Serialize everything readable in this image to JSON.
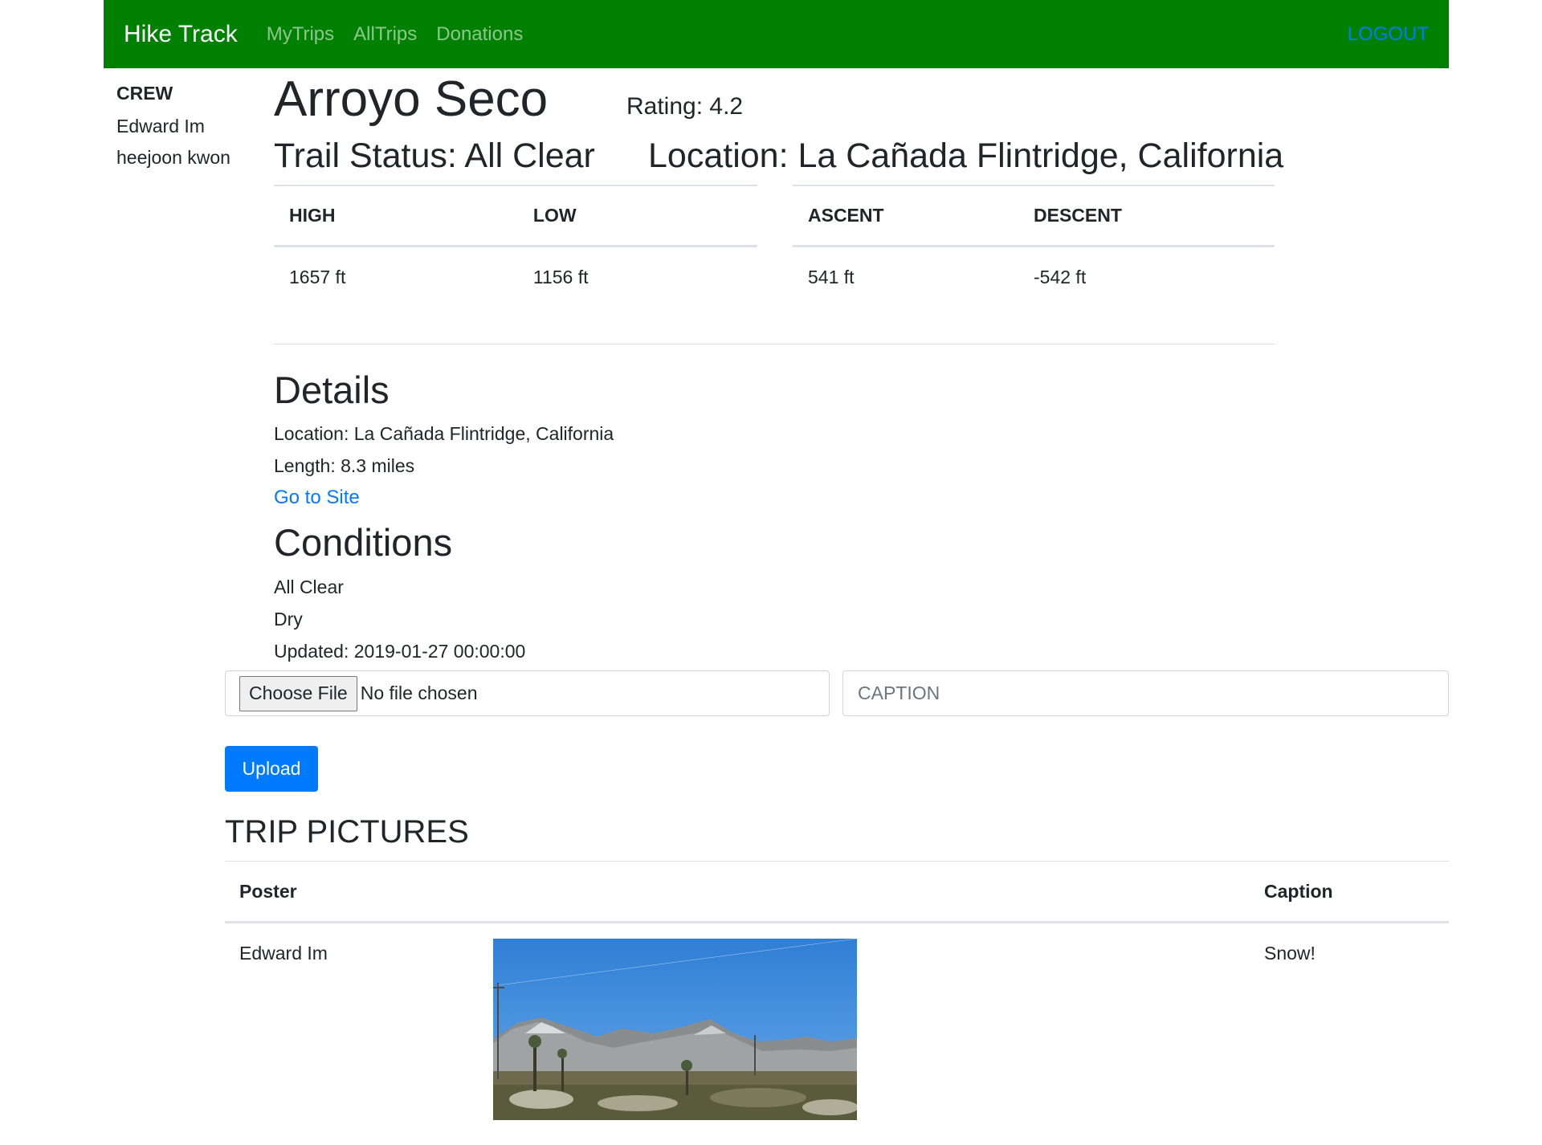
{
  "navbar": {
    "brand": "Hike Track",
    "links": [
      "MyTrips",
      "AllTrips",
      "Donations"
    ],
    "logout": "LOGOUT"
  },
  "crew": {
    "title": "CREW",
    "members": [
      "Edward Im",
      "heejoon kwon"
    ]
  },
  "trail": {
    "name": "Arroyo Seco",
    "rating": "Rating: 4.2",
    "status": "Trail Status: All Clear",
    "location": "Location: La Cañada Flintridge, California"
  },
  "elevation": {
    "headers_left": [
      "HIGH",
      "LOW"
    ],
    "values_left": [
      "1657 ft",
      "1156 ft"
    ],
    "headers_right": [
      "ASCENT",
      "DESCENT"
    ],
    "values_right": [
      "541 ft",
      "-542 ft"
    ]
  },
  "details": {
    "heading": "Details",
    "location": "Location: La Cañada Flintridge, California",
    "length": "Length: 8.3 miles",
    "link": "Go to Site"
  },
  "conditions": {
    "heading": "Conditions",
    "status": "All Clear",
    "surface": "Dry",
    "updated": "Updated: 2019-01-27 00:00:00"
  },
  "upload": {
    "choose_file": "Choose File",
    "file_status": "No file chosen",
    "caption_placeholder": "CAPTION",
    "button": "Upload"
  },
  "pictures": {
    "heading": "TRIP PICTURES",
    "headers": [
      "Poster",
      "",
      "Caption"
    ],
    "rows": [
      {
        "poster": "Edward Im",
        "caption": "Snow!"
      }
    ]
  }
}
